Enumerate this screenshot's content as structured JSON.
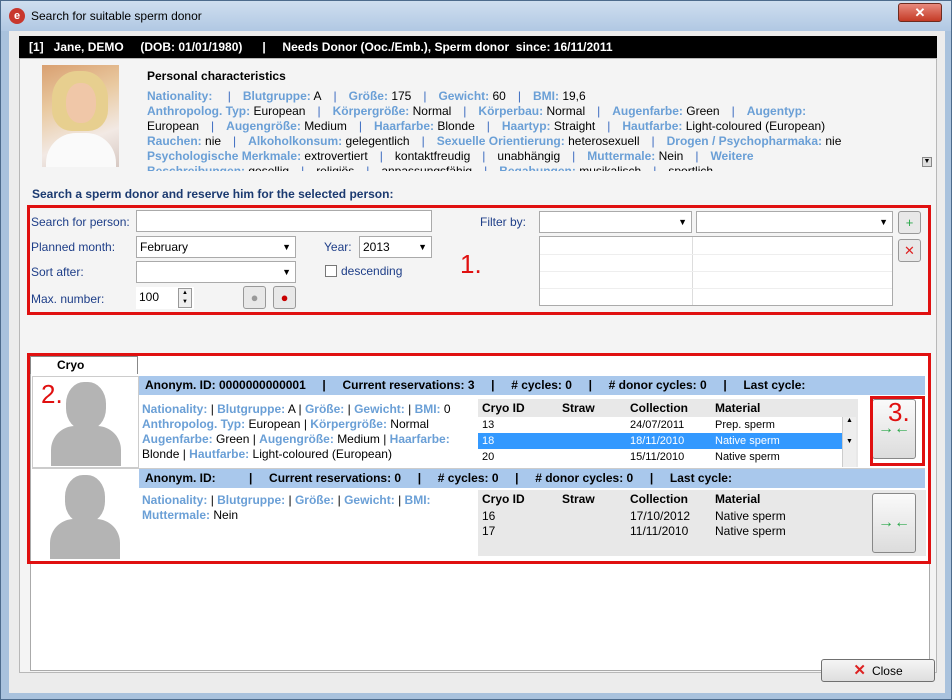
{
  "window": {
    "title": "Search for suitable sperm donor",
    "app_icon": "app-logo-icon",
    "close_glyph": "✕"
  },
  "patient_header": {
    "text": "[1]   Jane, DEMO     (DOB: 01/01/1980)      |     Needs Donor (Ooc./Emb.), Sperm donor  since: 16/11/2011"
  },
  "characteristics": {
    "title": "Personal characteristics",
    "lines": [
      [
        [
          "Nationality:",
          ""
        ],
        [
          "Blutgruppe:",
          "A"
        ],
        [
          "Größe:",
          "175"
        ],
        [
          "Gewicht:",
          "60"
        ],
        [
          "BMI:",
          "19,6"
        ]
      ],
      [
        [
          "Anthropolog. Typ:",
          "European"
        ],
        [
          "Körpergröße:",
          "Normal"
        ],
        [
          "Körperbau:",
          "Normal"
        ],
        [
          "Augenfarbe:",
          "Green"
        ],
        [
          "Augentyp:",
          ""
        ]
      ],
      [
        [
          "",
          "European"
        ],
        [
          "Augengröße:",
          "Medium"
        ],
        [
          "Haarfarbe:",
          "Blonde"
        ],
        [
          "Haartyp:",
          "Straight"
        ],
        [
          "Hautfarbe:",
          "Light-coloured (European)"
        ]
      ],
      [
        [
          "Rauchen:",
          "nie"
        ],
        [
          "Alkoholkonsum:",
          "gelegentlich"
        ],
        [
          "Sexuelle Orientierung:",
          "heterosexuell"
        ],
        [
          "Drogen / Psychopharmaka:",
          "nie"
        ]
      ],
      [
        [
          "Psychologische Merkmale:",
          "extrovertiert"
        ],
        [
          "",
          "kontaktfreudig"
        ],
        [
          "",
          "unabhängig"
        ],
        [
          "Muttermale:",
          "Nein"
        ],
        [
          "Weitere",
          ""
        ]
      ],
      [
        [
          "Beschreibungen:",
          "gesellig"
        ],
        [
          "",
          "religiös"
        ],
        [
          "",
          "anpassungsfähig"
        ],
        [
          "Begabungen:",
          "musikalisch"
        ],
        [
          "",
          "sportlich"
        ]
      ]
    ]
  },
  "search": {
    "section_title": "Search a sperm donor and reserve him for the selected person:",
    "search_person_label": "Search for person:",
    "search_person_value": "",
    "planned_month_label": "Planned month:",
    "planned_month_value": "February",
    "year_label": "Year:",
    "year_value": "2013",
    "sort_after_label": "Sort after:",
    "sort_after_value": "",
    "descending_label": "descending",
    "descending_checked": false,
    "max_number_label": "Max. number:",
    "max_number_value": "100",
    "filter_by_label": "Filter by:",
    "filter1_value": "",
    "filter2_value": "",
    "annotation_1": "1.",
    "annotation_2": "2.",
    "annotation_3": "3."
  },
  "tabs": [
    {
      "label": "Cryo donation"
    }
  ],
  "donors": [
    {
      "header": "Anonym. ID: 0000000000001     |     Current reservations: 3     |     # cycles: 0     |     # donor cycles: 0     |     Last cycle:",
      "info_lines": [
        [
          [
            "Nationality:",
            ""
          ],
          [
            "Blutgruppe:",
            "A"
          ],
          [
            "Größe:",
            ""
          ],
          [
            "Gewicht:",
            ""
          ],
          [
            "BMI:",
            "0"
          ]
        ],
        [
          [
            "Anthropolog. Typ:",
            "European"
          ],
          [
            "Körpergröße:",
            "Normal"
          ]
        ],
        [
          [
            "Augenfarbe:",
            "Green"
          ],
          [
            "Augengröße:",
            "Medium"
          ],
          [
            "Haarfarbe:",
            ""
          ]
        ],
        [
          [
            "",
            "Blonde"
          ],
          [
            "Hautfarbe:",
            "Light-coloured (European)"
          ]
        ]
      ],
      "columns": [
        "Cryo ID",
        "Straw",
        "Collection",
        "Material"
      ],
      "rows": [
        {
          "id": "13",
          "straw": "",
          "collection": "24/07/2011",
          "material": "Prep. sperm"
        },
        {
          "id": "18",
          "straw": "",
          "collection": "18/11/2010",
          "material": "Native sperm"
        },
        {
          "id": "20",
          "straw": "",
          "collection": "15/11/2010",
          "material": "Native sperm"
        }
      ]
    },
    {
      "header": "Anonym. ID:          |     Current reservations: 0     |     # cycles: 0     |     # donor cycles: 0     |     Last cycle:",
      "info_lines": [
        [
          [
            "Nationality:",
            ""
          ],
          [
            "Blutgruppe:",
            ""
          ],
          [
            "Größe:",
            ""
          ],
          [
            "Gewicht:",
            ""
          ],
          [
            "BMI:",
            ""
          ]
        ],
        [
          [
            "Muttermale:",
            "Nein"
          ]
        ]
      ],
      "columns": [
        "Cryo ID",
        "Straw",
        "Collection",
        "Material"
      ],
      "rows": [
        {
          "id": "16",
          "straw": "",
          "collection": "17/10/2012",
          "material": "Native sperm"
        },
        {
          "id": "17",
          "straw": "",
          "collection": "11/11/2010",
          "material": "Native sperm"
        }
      ]
    }
  ],
  "buttons": {
    "close_label": "Close"
  },
  "colors": {
    "label_blue": "#6a9fd6",
    "header_blue": "#a9c8ec",
    "selected_row": "#3399ff",
    "annotation_red": "#e01010"
  }
}
